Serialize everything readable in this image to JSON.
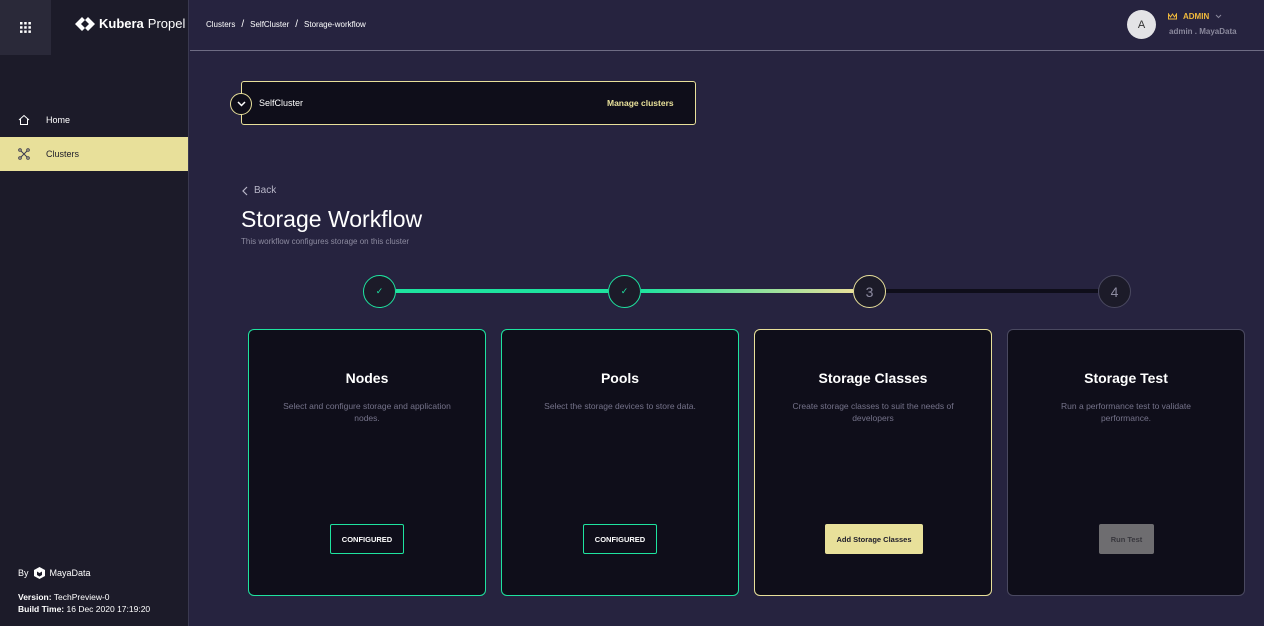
{
  "brand": {
    "name_bold": "Kubera",
    "name_light": "Propel"
  },
  "sidebar": {
    "items": [
      {
        "label": "Home",
        "icon": "home-icon"
      },
      {
        "label": "Clusters",
        "icon": "clusters-icon",
        "active": true
      }
    ],
    "by_label": "By",
    "by_brand": "MayaData",
    "version_label": "Version:",
    "version_value": "TechPreview-0",
    "build_label": "Build Time:",
    "build_value": "16 Dec 2020 17:19:20"
  },
  "header": {
    "breadcrumb": [
      "Clusters",
      "SelfCluster",
      "Storage-workflow"
    ],
    "avatar_letter": "A",
    "role": "ADMIN",
    "user": "admin . MayaData"
  },
  "cluster_select": {
    "selected": "SelfCluster",
    "manage_label": "Manage clusters"
  },
  "page": {
    "back_label": "Back",
    "title": "Storage Workflow",
    "subtitle": "This workflow configures storage on this cluster"
  },
  "stepper": {
    "steps": [
      {
        "label": "✓",
        "status": "done"
      },
      {
        "label": "✓",
        "status": "done"
      },
      {
        "label": "3",
        "status": "current"
      },
      {
        "label": "4",
        "status": "todo"
      }
    ]
  },
  "cards": [
    {
      "title": "Nodes",
      "desc": "Select and configure storage and application nodes.",
      "button": "CONFIGURED"
    },
    {
      "title": "Pools",
      "desc": "Select the storage devices to store data.",
      "button": "CONFIGURED"
    },
    {
      "title": "Storage Classes",
      "desc": "Create storage classes to suit the needs of developers",
      "button": "Add Storage Classes"
    },
    {
      "title": "Storage Test",
      "desc": "Run a performance test to validate performance.",
      "button": "Run Test"
    }
  ],
  "colors": {
    "accent": "#1ee39f",
    "highlight": "#e8e09a",
    "role": "#f0b93c"
  }
}
